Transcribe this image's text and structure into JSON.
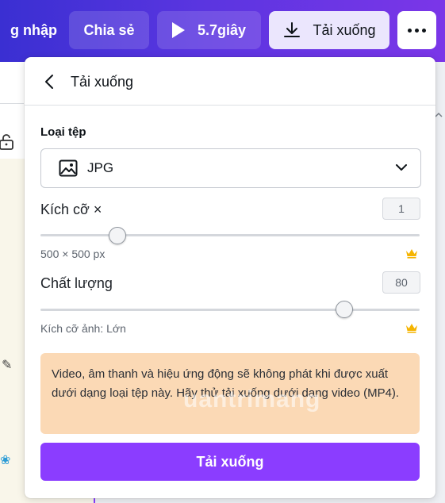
{
  "topbar": {
    "login_label": "g nhập",
    "share_label": "Chia sẻ",
    "play_label": "5.7giây",
    "download_label": "Tải xuống",
    "more_icon": "more-dots-icon"
  },
  "panel": {
    "title": "Tải xuống",
    "file_type_label": "Loại tệp",
    "file_type_value": "JPG",
    "size_label": "Kích cỡ ×",
    "size_value": "1",
    "size_slider_fraction": 0.2,
    "dimensions_text": "500 × 500 px",
    "quality_label": "Chất lượng",
    "quality_value": "80",
    "quality_slider_fraction": 0.8,
    "image_size_text": "Kích cỡ ảnh: Lớn",
    "notice_text": "Video, âm thanh và hiệu ứng động sẽ không phát khi được xuất dưới dạng loại tệp này. Hãy thử tải xuống dưới dạng video (MP4).",
    "download_button_label": "Tải xuống",
    "watermark_text": "uantrimang"
  },
  "colors": {
    "brand_purple": "#8b3dff",
    "topbar_start": "#3a2fd2",
    "topbar_end": "#7b36e8",
    "notice_bg": "#fbd9b5",
    "crown_gold": "#f5b400"
  }
}
